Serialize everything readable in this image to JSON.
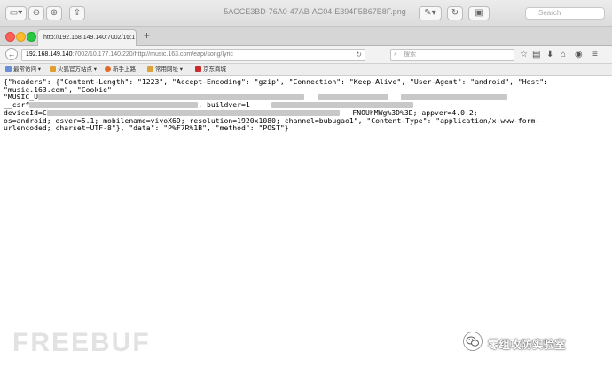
{
  "preview": {
    "title": "5ACCE3BD-76A0-47AB-AC04-E394F5B67B8F.png",
    "search_placeholder": "Search"
  },
  "browser": {
    "tab_label": "http://192.168.149.140:7002/10.1",
    "url_host": "192.168.149.140",
    "url_rest": ":7002/10.177.140.220/http://music.163.com/eapi/song/lyric",
    "search_placeholder": "搜索"
  },
  "bookmarks": [
    {
      "label": "最常访问",
      "icon_color": "#6a8fd6"
    },
    {
      "label": "火狐官方站点",
      "icon_color": "#e0a030"
    },
    {
      "label": "新手上路",
      "icon_color": "#e06a2a"
    },
    {
      "label": "常用网址",
      "icon_color": "#d9a23a"
    },
    {
      "label": "京东商城",
      "icon_color": "#cc2b2b"
    }
  ],
  "response": {
    "line1": "{\"headers\": {\"Content-Length\": \"1223\", \"Accept-Encoding\": \"gzip\", \"Connection\": \"Keep-Alive\", \"User-Agent\": \"android\", \"Host\":",
    "line2": "\"music.163.com\", \"Cookie\"",
    "line3": "\"MUSIC_U",
    "line4a": "__csrf",
    "line4b": ", buildver=1",
    "line5a": "deviceId=C",
    "line5b": "FNOUhMWg%3D%3D; appver=4.0.2;",
    "line6": "os=android; osver=5.1; mobilename=vivoX6D; resolution=1920x1080; channel=bubugao1\", \"Content-Type\": \"application/x-www-form-",
    "line7": "urlencoded; charset=UTF-8\"}, \"data\": \"P%F7R%1B\", \"method\": \"POST\"}"
  },
  "watermark": {
    "site": "FREEBUF",
    "lab": "零组攻防实验室"
  }
}
